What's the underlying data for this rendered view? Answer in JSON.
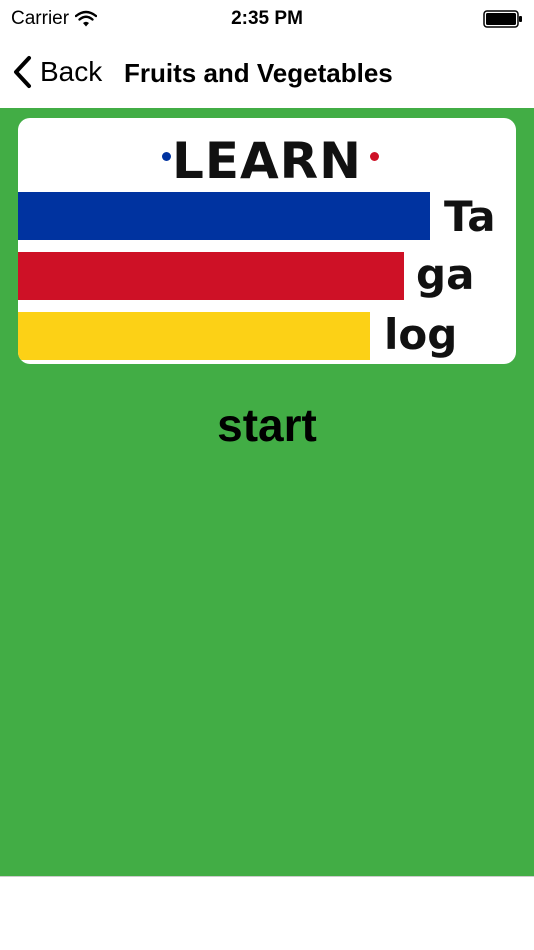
{
  "status_bar": {
    "carrier": "Carrier",
    "time": "2:35 PM"
  },
  "nav": {
    "back_label": "Back",
    "title": "Fruits and Vegetables"
  },
  "logo": {
    "word": "LEARN",
    "syllables": [
      "Ta",
      "ga",
      "log"
    ],
    "colors": {
      "blue": "#0033a0",
      "red": "#ce1126",
      "yellow": "#fcd116"
    }
  },
  "main": {
    "start_label": "start",
    "background": "#42ad45"
  }
}
